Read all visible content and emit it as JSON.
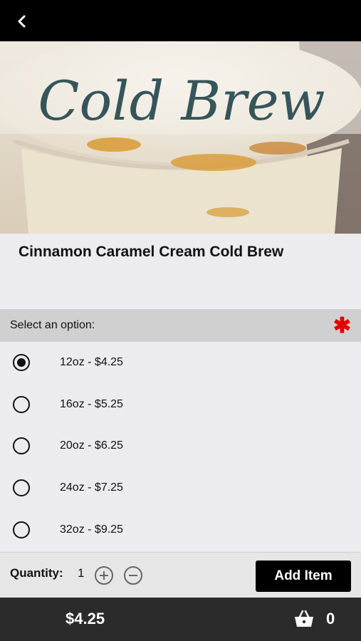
{
  "product": {
    "hero_script_text": "Cold Brew",
    "title": "Cinnamon Caramel Cream Cold Brew"
  },
  "options": {
    "header": "Select an option:",
    "required_marker": "✱",
    "items": [
      {
        "label": "12oz - $4.25",
        "selected": true
      },
      {
        "label": "16oz - $5.25",
        "selected": false
      },
      {
        "label": "20oz - $6.25",
        "selected": false
      },
      {
        "label": "24oz - $7.25",
        "selected": false
      },
      {
        "label": "32oz - $9.25",
        "selected": false
      }
    ]
  },
  "quantity": {
    "label": "Quantity:",
    "value": "1"
  },
  "actions": {
    "add_item": "Add Item"
  },
  "footer": {
    "total": "$4.25",
    "cart_count": "0"
  },
  "icons": {
    "back": "chevron-left-icon",
    "plus": "plus-circle-icon",
    "minus": "minus-circle-icon",
    "cart": "basket-icon"
  },
  "colors": {
    "topbar": "#000000",
    "required": "#e60000",
    "footer": "#2b2b2b",
    "button": "#000000"
  }
}
